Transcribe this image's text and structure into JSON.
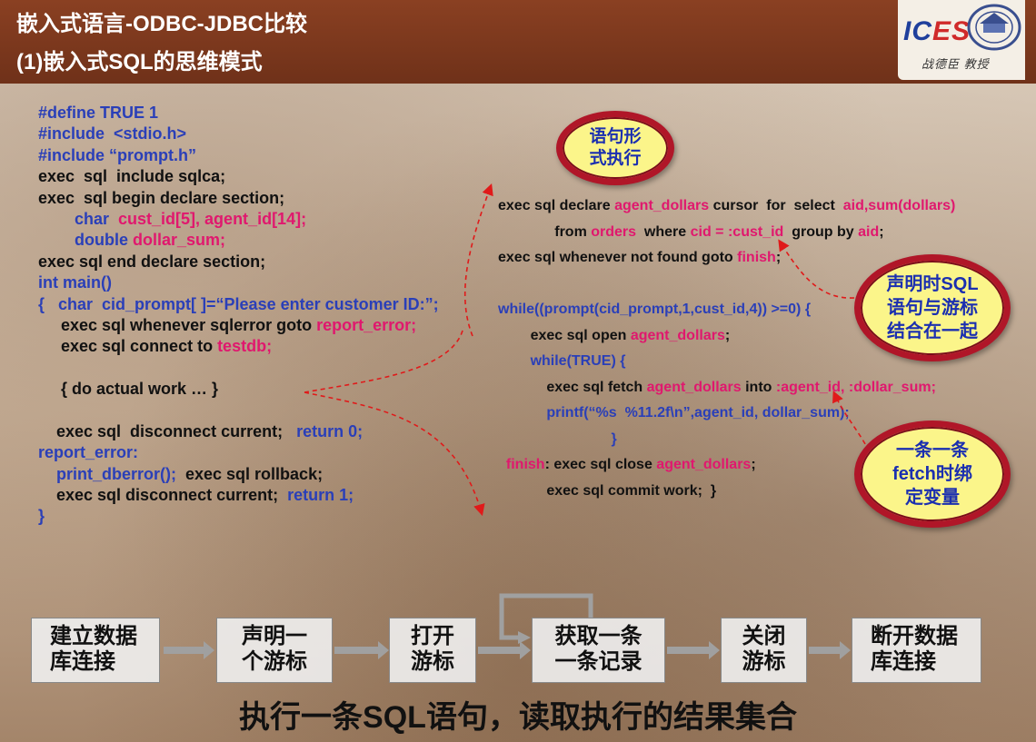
{
  "header": {
    "title": "嵌入式语言-ODBC-JDBC比较",
    "subtitle": "(1)嵌入式SQL的思维模式",
    "logo_text_a": "IC",
    "logo_text_b": "ES",
    "logo_author": "战德臣 教授"
  },
  "left_code": [
    [
      {
        "t": "#define TRUE 1",
        "c": "blue"
      }
    ],
    [
      {
        "t": "#include  <stdio.h>",
        "c": "blue"
      }
    ],
    [
      {
        "t": "#include “prompt.h”",
        "c": "blue"
      }
    ],
    [
      {
        "t": "exec  sql  include sqlca;",
        "c": ""
      }
    ],
    [
      {
        "t": "exec  sql begin declare section;",
        "c": ""
      }
    ],
    [
      {
        "t": "        char  ",
        "c": "blue"
      },
      {
        "t": "cust_id[5], agent_id[14];",
        "c": "pink"
      }
    ],
    [
      {
        "t": "        double ",
        "c": "blue"
      },
      {
        "t": "dollar_sum;",
        "c": "pink"
      }
    ],
    [
      {
        "t": "exec sql end declare section;",
        "c": ""
      }
    ],
    [
      {
        "t": "int main()",
        "c": "blue"
      }
    ],
    [
      {
        "t": "{   char  cid_prompt[ ]=“Please enter customer ID:”;",
        "c": "blue"
      }
    ],
    [
      {
        "t": "     exec sql whenever sqlerror goto ",
        "c": ""
      },
      {
        "t": "report_error;",
        "c": "pink"
      }
    ],
    [
      {
        "t": "     exec sql connect to ",
        "c": ""
      },
      {
        "t": "testdb;",
        "c": "pink"
      }
    ],
    [
      {
        "t": "",
        "c": ""
      }
    ],
    [
      {
        "t": "     { do actual work … }",
        "c": ""
      }
    ],
    [
      {
        "t": "",
        "c": ""
      }
    ],
    [
      {
        "t": "    exec sql  disconnect current;   ",
        "c": ""
      },
      {
        "t": "return 0;",
        "c": "blue"
      }
    ],
    [
      {
        "t": "report_error:",
        "c": "blue"
      }
    ],
    [
      {
        "t": "    print_dberror();  ",
        "c": "blue"
      },
      {
        "t": "exec sql rollback;",
        "c": ""
      }
    ],
    [
      {
        "t": "    exec sql disconnect current;  ",
        "c": ""
      },
      {
        "t": "return 1;",
        "c": "blue"
      }
    ],
    [
      {
        "t": "}",
        "c": "blue"
      }
    ]
  ],
  "right_code": [
    [
      {
        "t": "exec sql declare ",
        "c": ""
      },
      {
        "t": "agent_dollars",
        "c": "pink"
      },
      {
        "t": " cursor  for  select  ",
        "c": ""
      },
      {
        "t": "aid,sum(dollars)",
        "c": "pink"
      }
    ],
    [
      {
        "t": "              from ",
        "c": ""
      },
      {
        "t": "orders",
        "c": "pink"
      },
      {
        "t": "  where ",
        "c": ""
      },
      {
        "t": "cid = :cust_id",
        "c": "pink"
      },
      {
        "t": "  group by ",
        "c": ""
      },
      {
        "t": "aid",
        "c": "pink"
      },
      {
        "t": ";",
        "c": ""
      }
    ],
    [
      {
        "t": "exec sql whenever not found goto ",
        "c": ""
      },
      {
        "t": "finish",
        "c": "pink"
      },
      {
        "t": ";",
        "c": ""
      }
    ],
    [
      {
        "t": "",
        "c": ""
      }
    ],
    [
      {
        "t": "while((prompt(cid_prompt,1,cust_id,4)) >=0) {",
        "c": "blue"
      }
    ],
    [
      {
        "t": "        exec sql open ",
        "c": ""
      },
      {
        "t": "agent_dollars",
        "c": "pink"
      },
      {
        "t": ";",
        "c": ""
      }
    ],
    [
      {
        "t": "        while(TRUE) {",
        "c": "blue"
      }
    ],
    [
      {
        "t": "            exec sql fetch ",
        "c": ""
      },
      {
        "t": "agent_dollars",
        "c": "pink"
      },
      {
        "t": " into ",
        "c": ""
      },
      {
        "t": ":agent_id, :dollar_sum;",
        "c": "pink"
      }
    ],
    [
      {
        "t": "            printf(“%s  %11.2f\\n”,agent_id, dollar_sum);",
        "c": "blue"
      }
    ],
    [
      {
        "t": "                            }",
        "c": "blue"
      }
    ],
    [
      {
        "t": "  finish",
        "c": "pink"
      },
      {
        "t": ": exec sql close ",
        "c": ""
      },
      {
        "t": "agent_dollars",
        "c": "pink"
      },
      {
        "t": ";",
        "c": ""
      }
    ],
    [
      {
        "t": "            exec sql commit work;  }",
        "c": ""
      }
    ]
  ],
  "bubbles": {
    "b1_line1": "语句形",
    "b1_line2": "式执行",
    "b2_line1": "声明时SQL",
    "b2_line2": "语句与游标",
    "b2_line3": "结合在一起",
    "b3_line1": "一条一条",
    "b3_line2": "fetch时绑",
    "b3_line3": "定变量"
  },
  "flow": [
    {
      "l1": "建立数据",
      "l2": "库连接"
    },
    {
      "l1": "声明一",
      "l2": "个游标"
    },
    {
      "l1": "打开",
      "l2": "游标"
    },
    {
      "l1": "获取一条",
      "l2": "一条记录"
    },
    {
      "l1": "关闭",
      "l2": "游标"
    },
    {
      "l1": "断开数据",
      "l2": "库连接"
    }
  ],
  "caption": "执行一条SQL语句，读取执行的结果集合",
  "colors": {
    "header": "#7a3a1e",
    "code_blue": "#2a3fb8",
    "code_pink": "#e0186e",
    "bubble_fill": "#fbf58a",
    "bubble_ring": "#b01628"
  }
}
